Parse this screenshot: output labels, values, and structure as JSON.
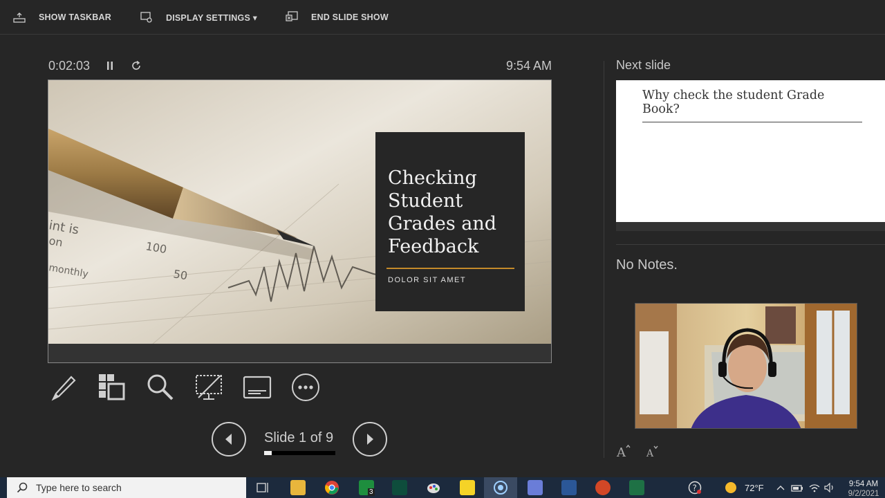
{
  "toolbar": {
    "show_taskbar": "SHOW TASKBAR",
    "display_settings": "DISPLAY SETTINGS ▾",
    "end_slide_show": "END SLIDE SHOW"
  },
  "presenter": {
    "elapsed_time": "0:02:03",
    "clock": "9:54 AM",
    "current_slide": {
      "title": "Checking Student Grades and Feedback",
      "subtitle": "DOLOR SIT AMET",
      "accent_color": "#c48a2a"
    },
    "tools": [
      {
        "name": "pen-tool",
        "icon": "pen-icon"
      },
      {
        "name": "see-all-slides",
        "icon": "slides-grid-icon"
      },
      {
        "name": "zoom",
        "icon": "magnifier-icon"
      },
      {
        "name": "black-screen",
        "icon": "monitor-off-icon"
      },
      {
        "name": "subtitles",
        "icon": "subtitles-icon"
      },
      {
        "name": "more-options",
        "icon": "ellipsis-icon"
      }
    ],
    "navigation": {
      "counter": "Slide 1 of 9",
      "current": 1,
      "total": 9
    }
  },
  "right_pane": {
    "next_label": "Next slide",
    "next_slide_title": "Why check the student Grade Book?",
    "notes": "No Notes."
  },
  "taskbar": {
    "search_placeholder": "Type here to search",
    "weather": "72°F",
    "time": "9:54 AM",
    "date": "9/2/2021",
    "badge_count": "3",
    "apps": [
      "task-view-icon",
      "file-explorer-icon",
      "chrome-icon",
      "sheets-icon",
      "app-icon",
      "paint-icon",
      "sticky-notes-icon",
      "cortana-icon",
      "teams-icon",
      "word-icon",
      "powerpoint-icon",
      "excel-icon"
    ]
  }
}
